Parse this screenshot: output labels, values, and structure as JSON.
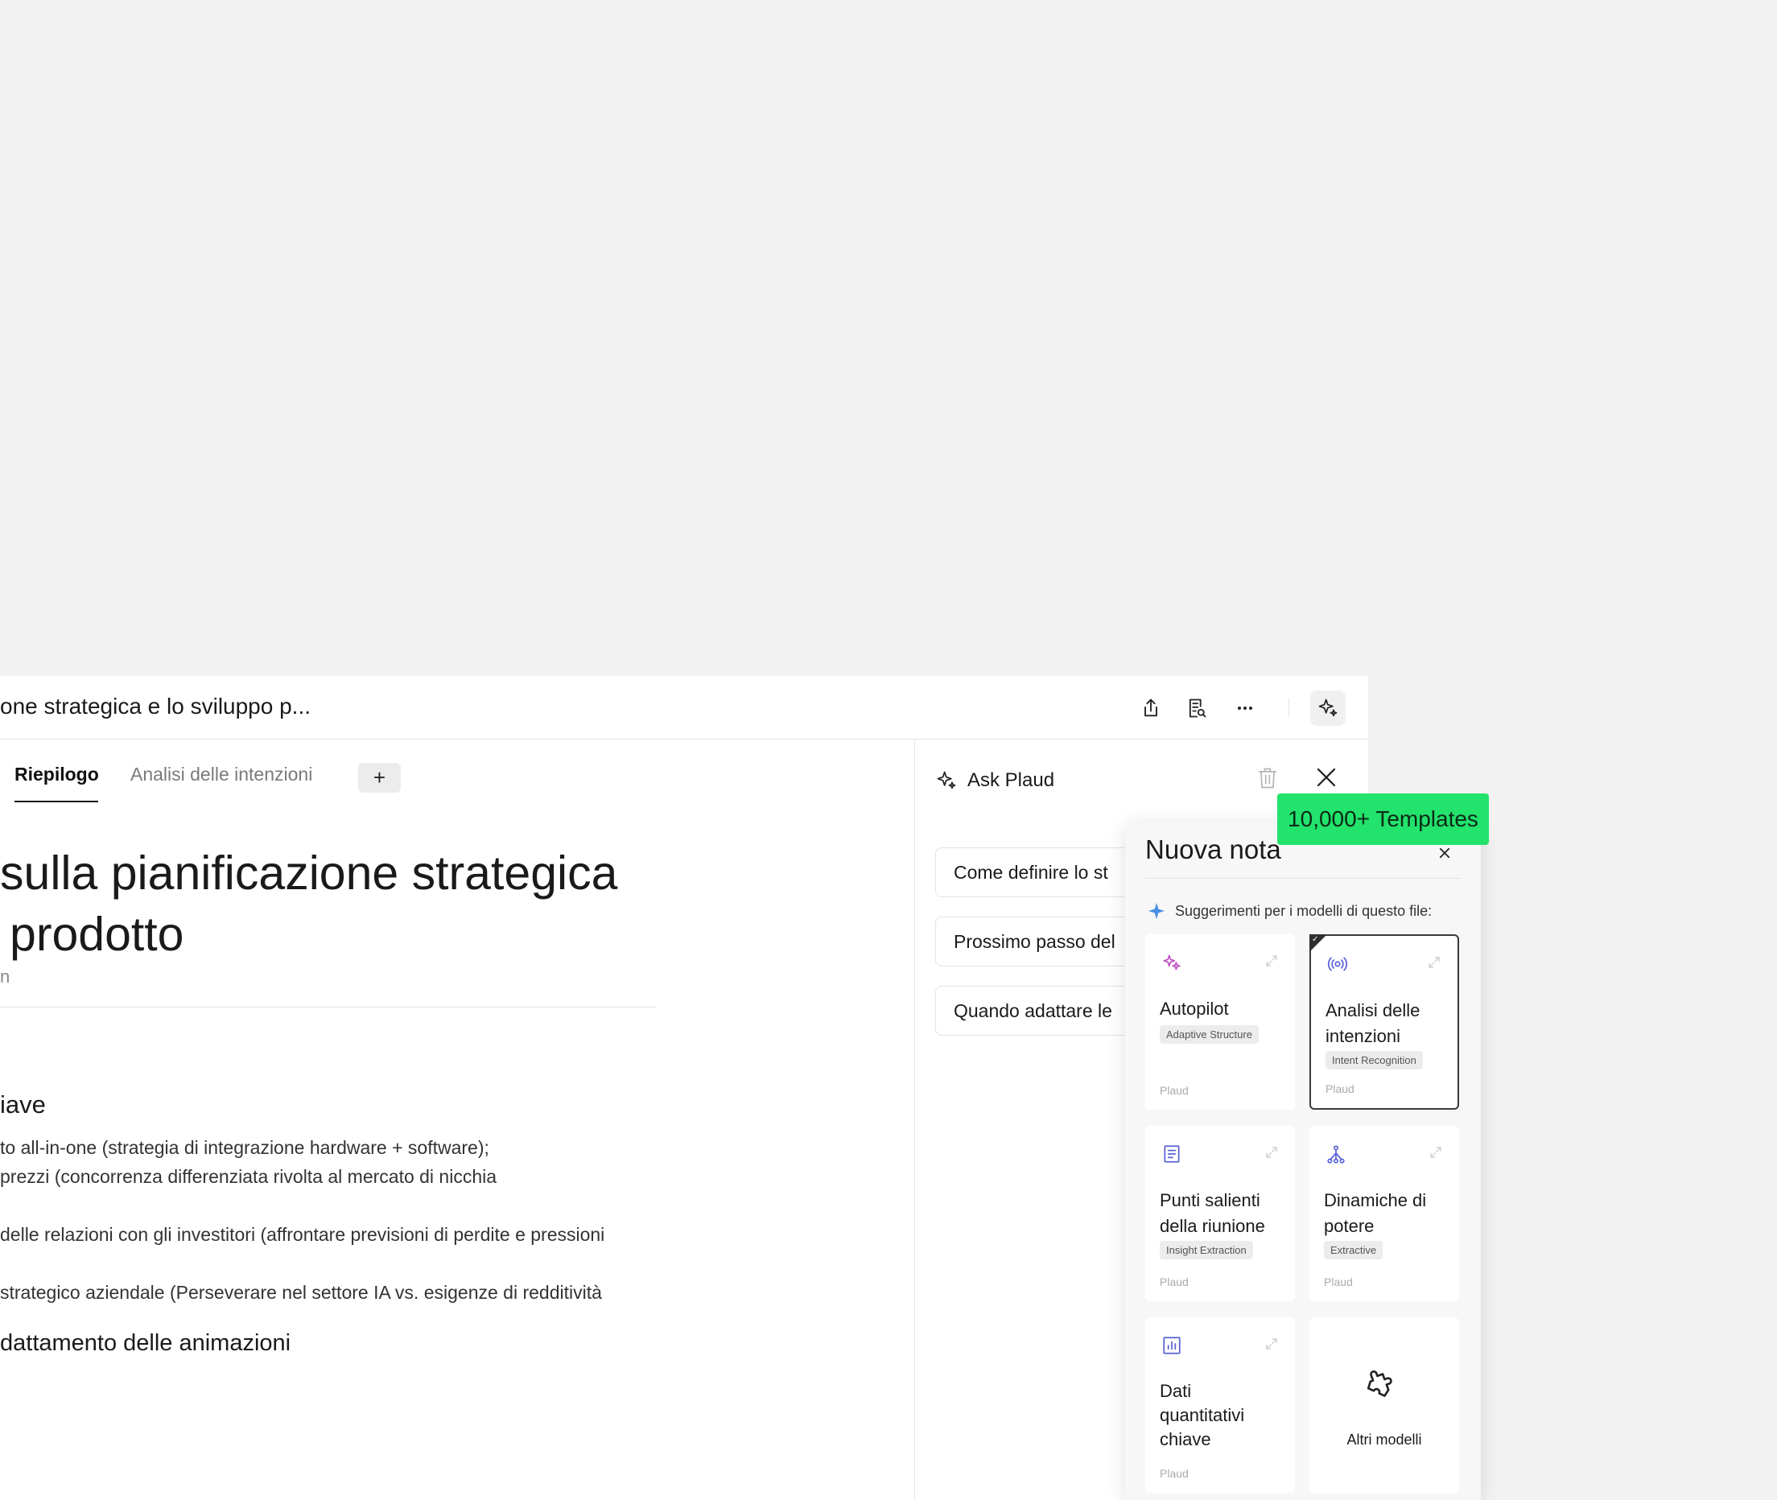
{
  "topbar": {
    "doc_title": "one strategica e lo sviluppo p...",
    "icons": [
      "share-icon",
      "document-search-icon",
      "more-dots-icon",
      "ai-sparkle-icon"
    ]
  },
  "tabs": [
    {
      "label": "Riepilogo",
      "active": true
    },
    {
      "label": "Analisi delle intenzioni",
      "active": false
    }
  ],
  "tab_add_label": "+",
  "document": {
    "title_line1": "sulla pianificazione strategica",
    "title_line2": "prodotto",
    "meta_fragment": "n",
    "section_heading": "iave",
    "lines": [
      "to all-in-one (strategia di integrazione hardware + software);",
      " prezzi (concorrenza differenziata rivolta al mercato di nicchia",
      "delle relazioni con gli investitori (affrontare previsioni di perdite e pressioni",
      " strategico aziendale (Perseverare nel settore IA vs. esigenze di redditività"
    ],
    "subheading": "dattamento delle animazioni"
  },
  "ask": {
    "title": "Ask Plaud",
    "prompts": [
      "Come definire lo st",
      "Prossimo passo del",
      "Quando adattare le"
    ]
  },
  "popup": {
    "title": "Nuova nota",
    "suggestion_text": "Suggerimenti per i modelli di questo file:",
    "cards": [
      {
        "title": "Autopilot",
        "tag": "Adaptive Structure",
        "owner": "Plaud",
        "icon": "sparkles-icon",
        "icon_color": "#c04ac4",
        "selected": false
      },
      {
        "title": "Analisi delle intenzioni",
        "tag": "Intent Recognition",
        "owner": "Plaud",
        "icon": "broadcast-icon",
        "icon_color": "#5a62d6",
        "selected": true
      },
      {
        "title": "Punti salienti della riunione",
        "tag": "Insight Extraction",
        "owner": "Plaud",
        "icon": "document-lines-icon",
        "icon_color": "#5a62d6",
        "selected": false
      },
      {
        "title": "Dinamiche di potere",
        "tag": "Extractive",
        "owner": "Plaud",
        "icon": "network-icon",
        "icon_color": "#5a62d6",
        "selected": false
      },
      {
        "title": "Dati quantitativi chiave",
        "tag": "",
        "owner": "Plaud",
        "icon": "bar-chart-icon",
        "icon_color": "#5a62d6",
        "selected": false
      }
    ],
    "more_label": "Altri modelli"
  },
  "badge": "10,000+ Templates",
  "colors": {
    "badge_bg": "#22e36c",
    "accent_blue": "#4a90e2",
    "accent_purple": "#5a62d6",
    "accent_pink": "#c04ac4"
  }
}
